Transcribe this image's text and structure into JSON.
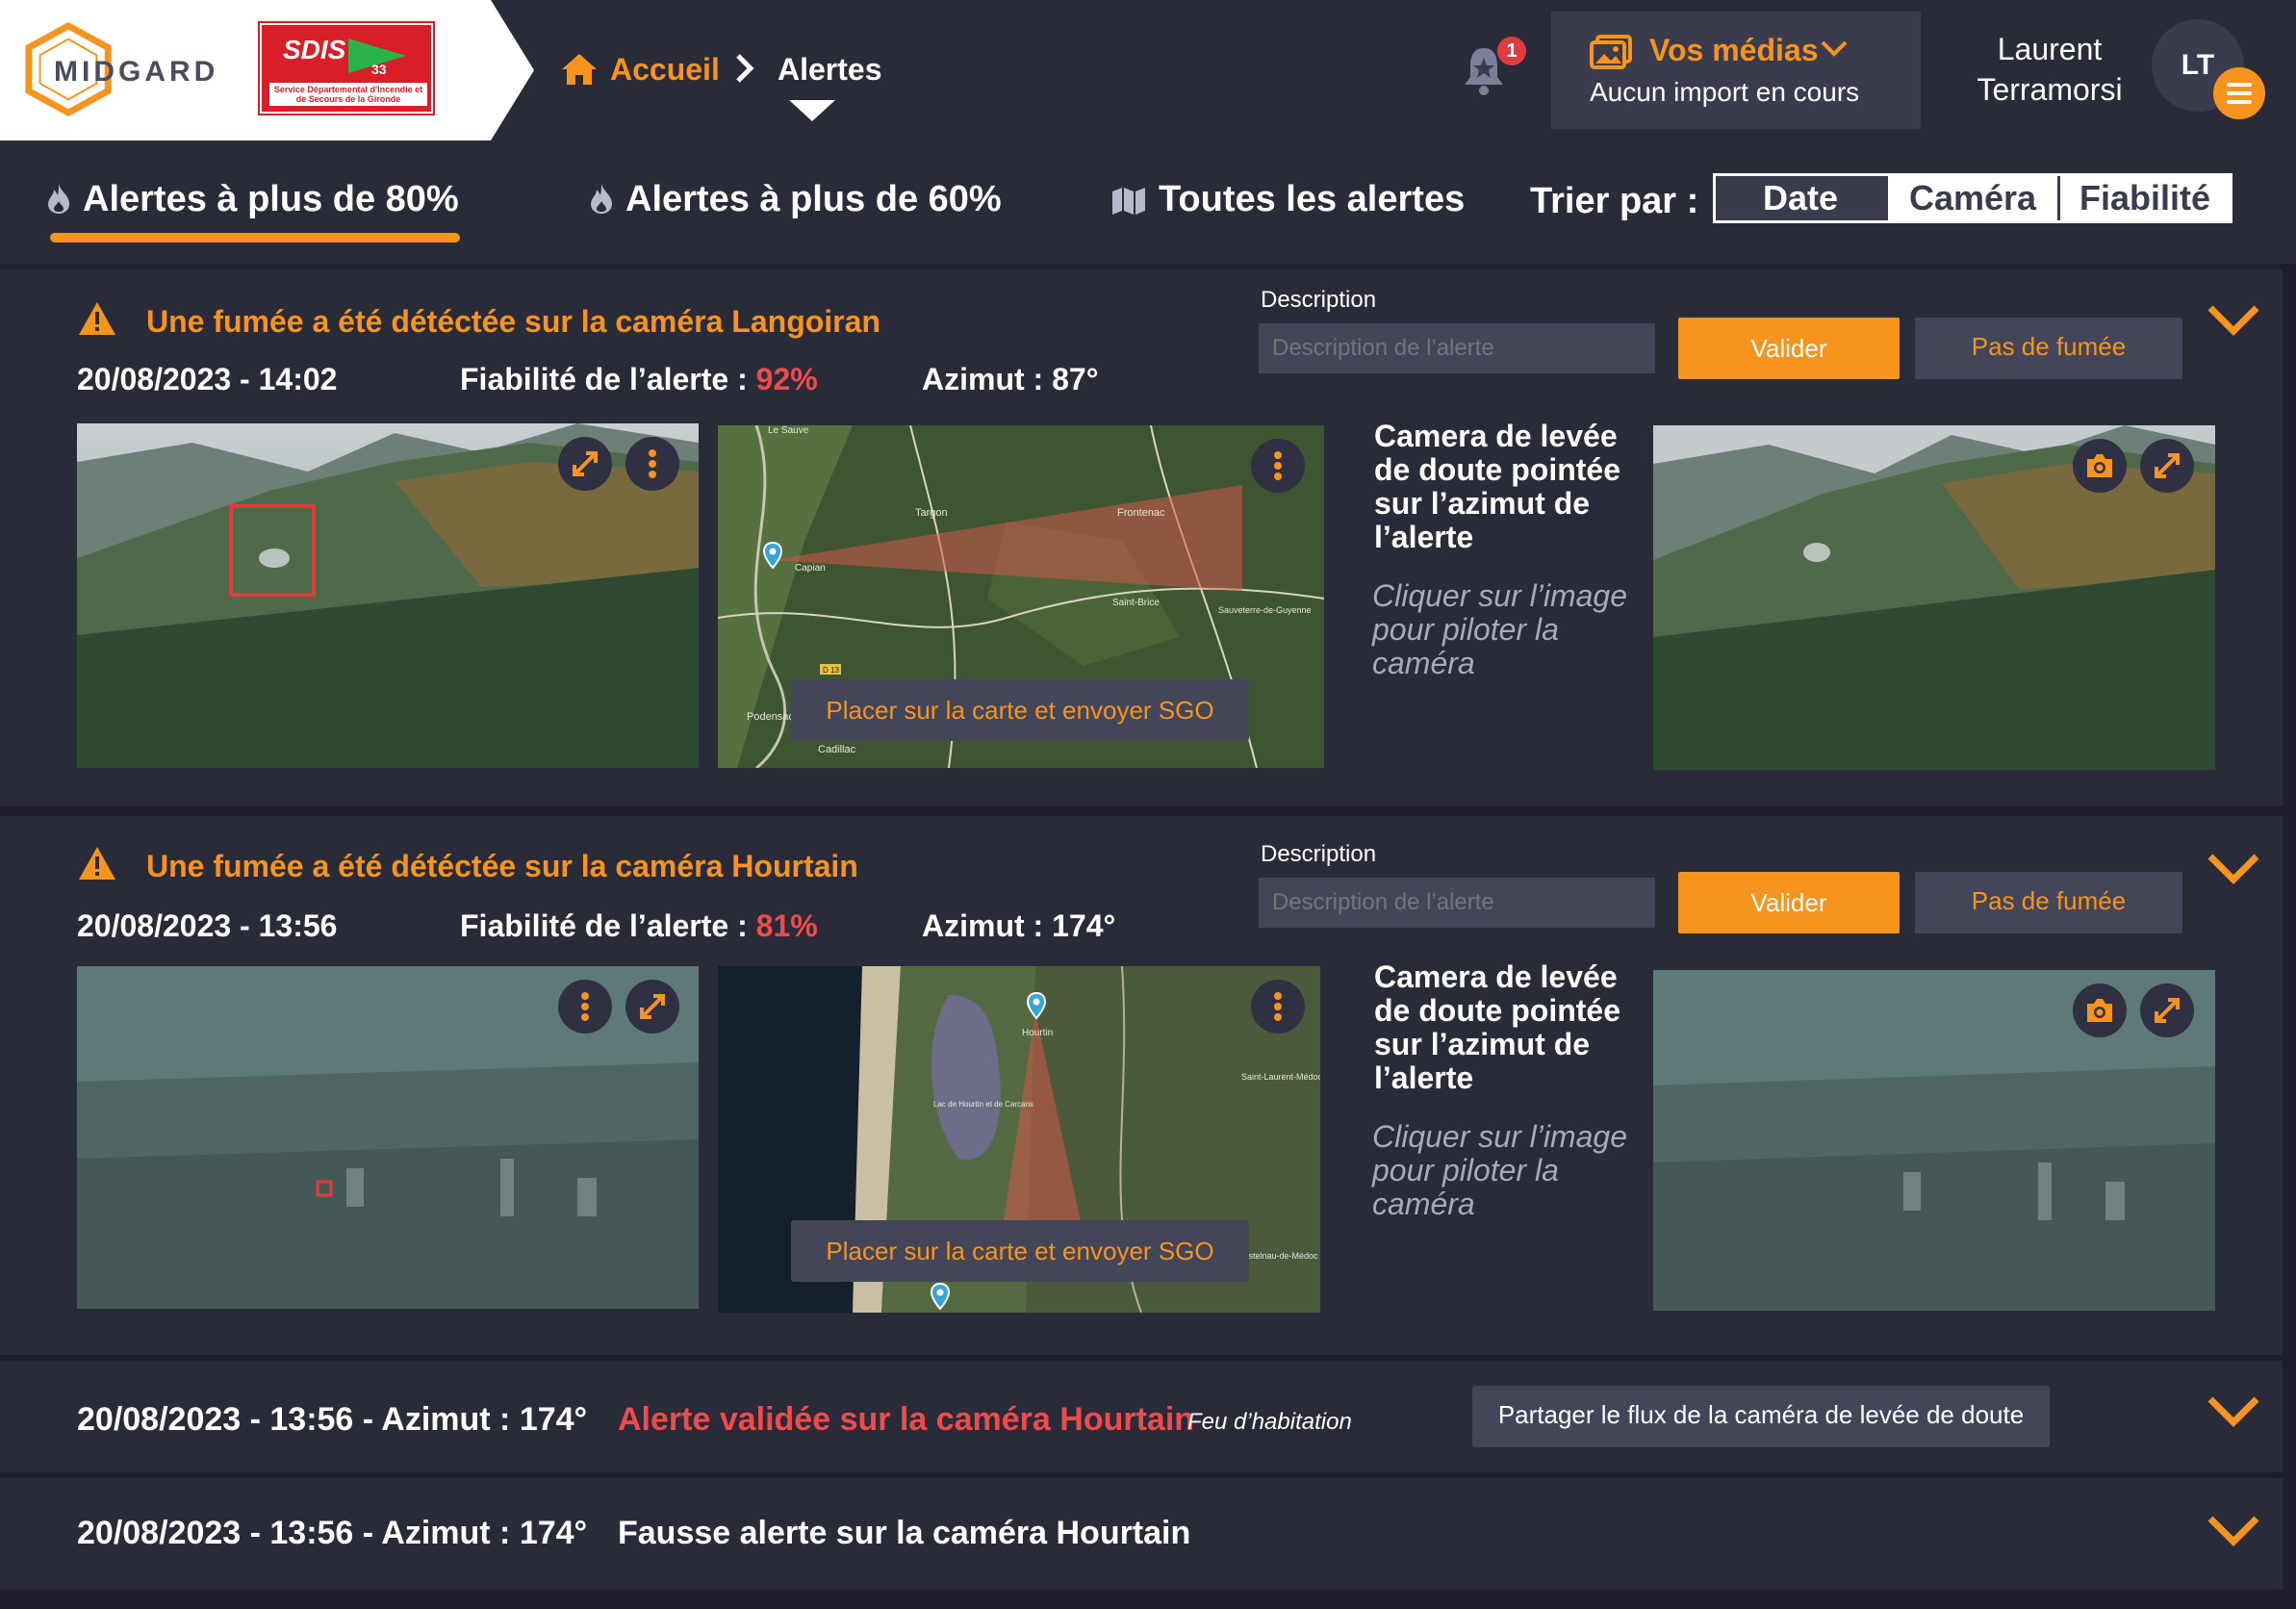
{
  "header": {
    "logo_text": "MIDGARD",
    "sdis_logo_text": "SDIS",
    "sdis_logo_number": "33",
    "sdis_logo_caption": "Service Départemental d'Incendie et de Secours de la Gironde",
    "breadcrumb_home": "Accueil",
    "breadcrumb_separator": ">",
    "breadcrumb_current": "Alertes",
    "notification_count": "1",
    "media_title": "Vos médias",
    "media_status": "Aucun import en cours",
    "user_first_name": "Laurent",
    "user_last_name": "Terramorsi",
    "user_initials": "LT"
  },
  "tabs": [
    {
      "label": "Alertes à plus de 80%",
      "active": true
    },
    {
      "label": "Alertes à plus de 60%",
      "active": false
    },
    {
      "label": "Toutes les alertes",
      "active": false
    }
  ],
  "sort": {
    "label": "Trier par :",
    "options": [
      "Date",
      "Caméra",
      "Fiabilité"
    ],
    "selected": "Date"
  },
  "alerts": [
    {
      "title": "Une fumée a été détéctée sur la caméra Langoiran",
      "datetime": "20/08/2023 - 14:02",
      "reliability_label": "Fiabilité de l’alerte :",
      "reliability_value": "92%",
      "azimuth": "Azimut : 87°",
      "description_label": "Description",
      "description_placeholder": "Description de l’alerte",
      "validate_label": "Valider",
      "no_smoke_label": "Pas de fumée",
      "map_button_label": "Placer sur la carte et envoyer SGO",
      "map_places": [
        "Le Sauve",
        "Targon",
        "Frontenac",
        "Capian",
        "Saint-Brice",
        "Sauveterre-de-Guyenne",
        "Podensac",
        "Cadillac",
        "D 13"
      ],
      "camera_title": "Camera de levée de doute pointée sur l’azimut de l’alerte",
      "camera_hint": "Cliquer sur l’image pour piloter la caméra"
    },
    {
      "title": "Une fumée a été détéctée sur la caméra Hourtain",
      "datetime": "20/08/2023 - 13:56",
      "reliability_label": "Fiabilité de l’alerte :",
      "reliability_value": "81%",
      "azimuth": "Azimut : 174°",
      "description_label": "Description",
      "description_placeholder": "Description de l’alerte",
      "validate_label": "Valider",
      "no_smoke_label": "Pas de fumée",
      "map_button_label": "Placer sur la carte et envoyer SGO",
      "map_places": [
        "Hourtin",
        "Saint-Laurent-Médoc",
        "Lac de Hourtin et de Carcans",
        "Castelnau-de-Médoc"
      ],
      "camera_title": "Camera de levée de doute pointée sur l’azimut de l’alerte",
      "camera_hint": "Cliquer sur l’image pour piloter la caméra"
    }
  ],
  "history": [
    {
      "datetime_azimuth": "20/08/2023 - 13:56 - Azimut : 174°",
      "message": "Alerte validée sur la caméra Hourtain",
      "message_color": "#ef4b4b",
      "note": "Feu d’habitation",
      "share_label": "Partager le flux de la caméra de levée de doute"
    },
    {
      "datetime_azimuth": "20/08/2023 - 13:56 - Azimut : 174°",
      "message": "Fausse alerte sur la caméra Hourtain",
      "message_color": "#ffffff"
    }
  ],
  "colors": {
    "accent": "#f7941d",
    "danger": "#ef4b4b",
    "panel": "#292b38",
    "background": "#1e1f2a",
    "control": "#434659"
  },
  "icons": [
    "home-icon",
    "chevron-right-icon",
    "bell-icon",
    "media-icon",
    "chevron-down-icon",
    "menu-icon",
    "flame-icon",
    "map-icon",
    "warning-icon",
    "expand-icon",
    "more-vertical-icon",
    "camera-icon",
    "map-pin-icon"
  ]
}
